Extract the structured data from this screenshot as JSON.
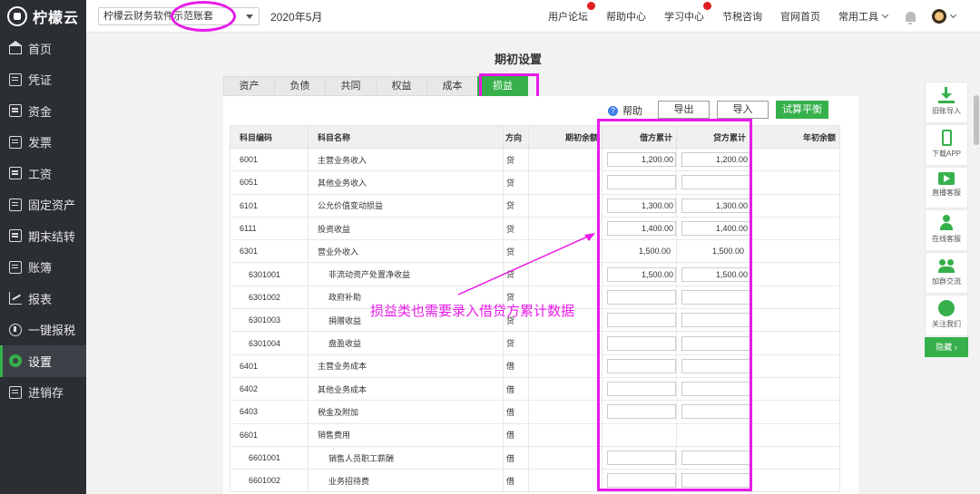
{
  "app": {
    "name": "柠檬云"
  },
  "sidebar": {
    "items": [
      {
        "label": "首页",
        "icon": "home-icon"
      },
      {
        "label": "凭证",
        "icon": "voucher-icon"
      },
      {
        "label": "资金",
        "icon": "fund-icon"
      },
      {
        "label": "发票",
        "icon": "invoice-icon"
      },
      {
        "label": "工资",
        "icon": "salary-icon"
      },
      {
        "label": "固定资产",
        "icon": "fixed-asset-icon"
      },
      {
        "label": "期末结转",
        "icon": "period-close-icon"
      },
      {
        "label": "账簿",
        "icon": "ledger-icon"
      },
      {
        "label": "报表",
        "icon": "report-icon"
      },
      {
        "label": "一键报税",
        "icon": "tax-icon"
      },
      {
        "label": "设置",
        "icon": "settings-icon",
        "active": true
      },
      {
        "label": "进销存",
        "icon": "inventory-icon"
      }
    ]
  },
  "topbar": {
    "account_set": "柠檬云财务软件示范账套",
    "period": "2020年5月",
    "links": [
      "用户论坛",
      "帮助中心",
      "学习中心",
      "节税咨询",
      "官网首页",
      "常用工具"
    ]
  },
  "page": {
    "title": "期初设置",
    "tabs": [
      "资产",
      "负债",
      "共同",
      "权益",
      "成本",
      "损益"
    ],
    "active_tab": "损益",
    "help_label": "帮助",
    "export_label": "导出",
    "import_label": "导入",
    "trial_balance_label": "试算平衡"
  },
  "table": {
    "headers": [
      "科目编码",
      "科目名称",
      "方向",
      "期初余额",
      "借方累计",
      "贷方累计",
      "年初余额"
    ],
    "rows": [
      {
        "code": "6001",
        "name": "主营业务收入",
        "dir": "贷",
        "debit": "1,200.00",
        "credit": "1,200.00",
        "input": true,
        "level": 0
      },
      {
        "code": "6051",
        "name": "其他业务收入",
        "dir": "贷",
        "debit": "",
        "credit": "",
        "input": true,
        "level": 0
      },
      {
        "code": "6101",
        "name": "公允价值变动损益",
        "dir": "贷",
        "debit": "1,300.00",
        "credit": "1,300.00",
        "input": true,
        "level": 0
      },
      {
        "code": "6111",
        "name": "投资收益",
        "dir": "贷",
        "debit": "1,400.00",
        "credit": "1,400.00",
        "input": true,
        "level": 0
      },
      {
        "code": "6301",
        "name": "营业外收入",
        "dir": "贷",
        "debit": "1,500.00",
        "credit": "1,500.00",
        "input": false,
        "level": 0
      },
      {
        "code": "6301001",
        "name": "非流动资产处置净收益",
        "dir": "贷",
        "debit": "1,500.00",
        "credit": "1,500.00",
        "input": true,
        "level": 1
      },
      {
        "code": "6301002",
        "name": "政府补助",
        "dir": "贷",
        "debit": "",
        "credit": "",
        "input": true,
        "level": 1
      },
      {
        "code": "6301003",
        "name": "捐赠收益",
        "dir": "贷",
        "debit": "",
        "credit": "",
        "input": true,
        "level": 1
      },
      {
        "code": "6301004",
        "name": "盘盈收益",
        "dir": "贷",
        "debit": "",
        "credit": "",
        "input": true,
        "level": 1
      },
      {
        "code": "6401",
        "name": "主营业务成本",
        "dir": "借",
        "debit": "",
        "credit": "",
        "input": true,
        "level": 0
      },
      {
        "code": "6402",
        "name": "其他业务成本",
        "dir": "借",
        "debit": "",
        "credit": "",
        "input": true,
        "level": 0
      },
      {
        "code": "6403",
        "name": "税金及附加",
        "dir": "借",
        "debit": "",
        "credit": "",
        "input": true,
        "level": 0
      },
      {
        "code": "6601",
        "name": "销售费用",
        "dir": "借",
        "debit": "",
        "credit": "",
        "input": false,
        "level": 0
      },
      {
        "code": "6601001",
        "name": "销售人员职工薪酬",
        "dir": "借",
        "debit": "",
        "credit": "",
        "input": true,
        "level": 1
      },
      {
        "code": "6601002",
        "name": "业务招待费",
        "dir": "借",
        "debit": "",
        "credit": "",
        "input": true,
        "level": 1
      }
    ]
  },
  "annotation": {
    "text": "损益类也需要录入借贷方累计数据",
    "color": "#e81ae8"
  },
  "side_tools": [
    {
      "label": "旧账导入",
      "icon": "download-icon"
    },
    {
      "label": "下载APP",
      "icon": "phone-icon"
    },
    {
      "label": "直播客服",
      "icon": "video-icon"
    },
    {
      "label": "在线客服",
      "icon": "person-icon"
    },
    {
      "label": "加群交流",
      "icon": "group-icon"
    },
    {
      "label": "关注我们",
      "icon": "wechat-icon"
    }
  ],
  "side_hide_label": "隐藏 ›",
  "colors": {
    "accent": "#36b04b",
    "highlight": "#e81ae8",
    "sidebar_bg": "#2b2e33"
  }
}
